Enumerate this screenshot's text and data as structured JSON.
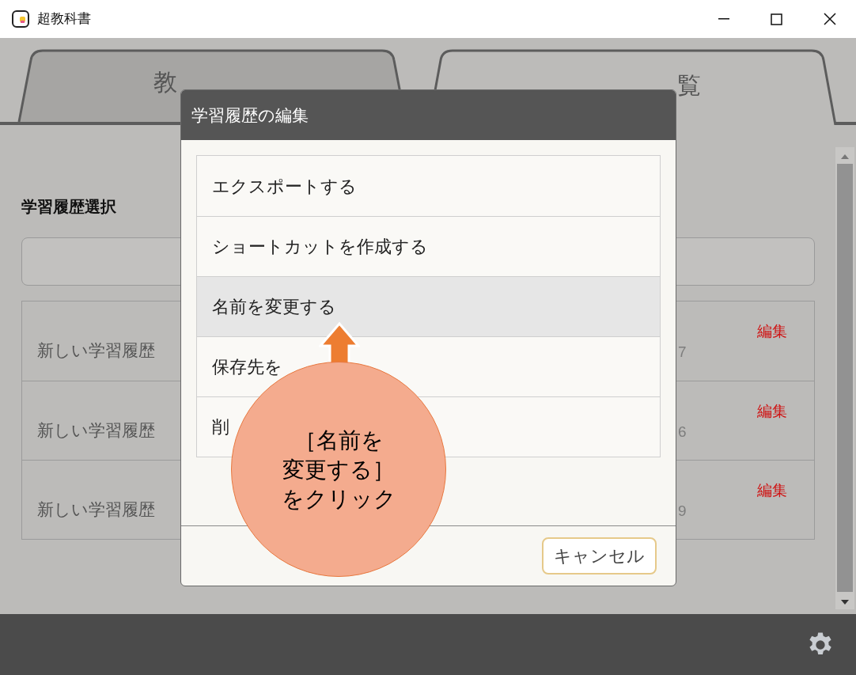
{
  "window": {
    "title": "超教科書"
  },
  "tabs": [
    {
      "label": "教",
      "selected": false
    },
    {
      "label": "覧",
      "selected": true
    }
  ],
  "section_title": "学習履歴選択",
  "history_rows": [
    {
      "name": "新しい学習履歴",
      "column_2": "7",
      "action": "編集"
    },
    {
      "name": "新しい学習履歴",
      "column_2": "6",
      "action": "編集"
    },
    {
      "name": "新しい学習履歴",
      "column_2": "9",
      "action": "編集"
    }
  ],
  "dialog": {
    "title": "学習履歴の編集",
    "items": [
      {
        "label": "エクスポートする",
        "selected": false
      },
      {
        "label": "ショートカットを作成する",
        "selected": false
      },
      {
        "label": "名前を変更する",
        "selected": true
      },
      {
        "label": "保存先を",
        "selected": false
      },
      {
        "label": "削",
        "selected": false
      }
    ],
    "cancel": "キャンセル"
  },
  "callout": {
    "lines": [
      "［名前を",
      "変更する］",
      "をクリック"
    ]
  }
}
